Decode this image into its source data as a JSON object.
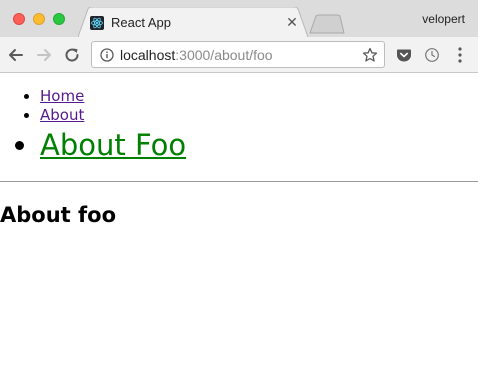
{
  "browser": {
    "tab": {
      "title": "React App"
    },
    "profile_name": "velopert",
    "address": {
      "host": "localhost",
      "path": ":3000/about/foo"
    }
  },
  "page": {
    "nav": {
      "items": [
        {
          "label": "Home"
        },
        {
          "label": "About"
        },
        {
          "label": "About Foo"
        }
      ]
    },
    "heading": "About foo"
  },
  "colors": {
    "link": "#551a8b",
    "active_link": "#008000",
    "react_logo": "#61dafb"
  },
  "icons": {
    "favicon": "react-logo-icon",
    "back": "back-arrow-icon",
    "forward": "forward-arrow-icon",
    "reload": "reload-icon",
    "info": "info-icon",
    "bookmark": "star-icon",
    "pocket": "pocket-icon",
    "clock": "clock-icon",
    "menu": "kebab-menu-icon",
    "close": "close-icon"
  }
}
